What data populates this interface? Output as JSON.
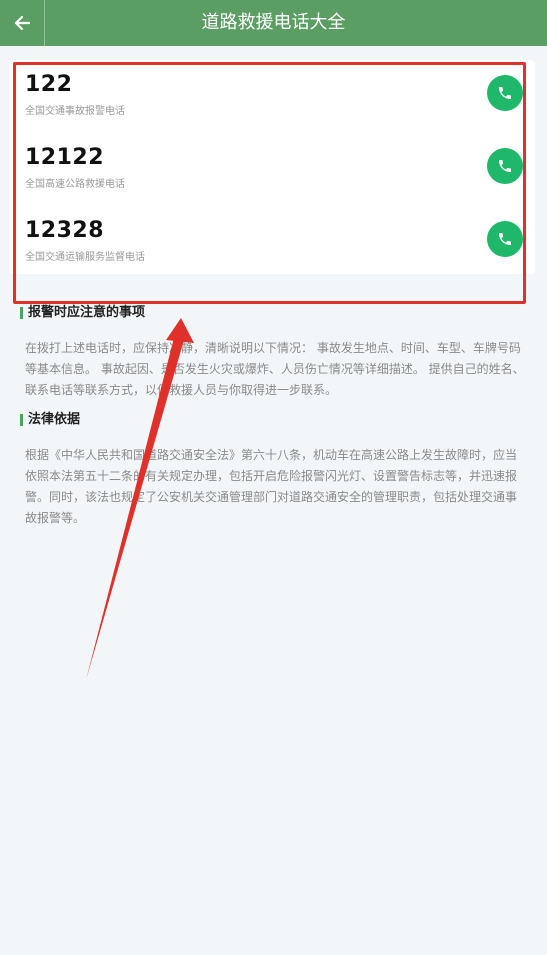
{
  "header": {
    "title": "道路救援电话大全",
    "back_icon": "arrow-left-icon"
  },
  "hotlines": [
    {
      "number": "122",
      "description": "全国交通事故报警电话"
    },
    {
      "number": "12122",
      "description": "全国高速公路救援电话"
    },
    {
      "number": "12328",
      "description": "全国交通运输服务监督电话"
    }
  ],
  "call_icon": "phone-icon",
  "sections": [
    {
      "title": "报警时应注意的事项",
      "body": "在拨打上述电话时，应保持冷静，清晰说明以下情况： 事故发生地点、时间、车型、车牌号码等基本信息。 事故起因、是否发生火灾或爆炸、人员伤亡情况等详细描述。 提供自己的姓名、联系电话等联系方式，以便救援人员与你取得进一步联系。"
    },
    {
      "title": "法律依据",
      "body": "根据《中华人民共和国道路交通安全法》第六十八条，机动车在高速公路上发生故障时，应当依照本法第五十二条的有关规定办理，包括开启危险报警闪光灯、设置警告标志等，并迅速报警。同时，该法也规定了公安机关交通管理部门对道路交通安全的管理职责，包括处理交通事故报警等。"
    }
  ],
  "colors": {
    "header": "#5b9e63",
    "call_button": "#1fb86a",
    "annotation": "#e0302a",
    "section_accent": "#49a55a"
  }
}
